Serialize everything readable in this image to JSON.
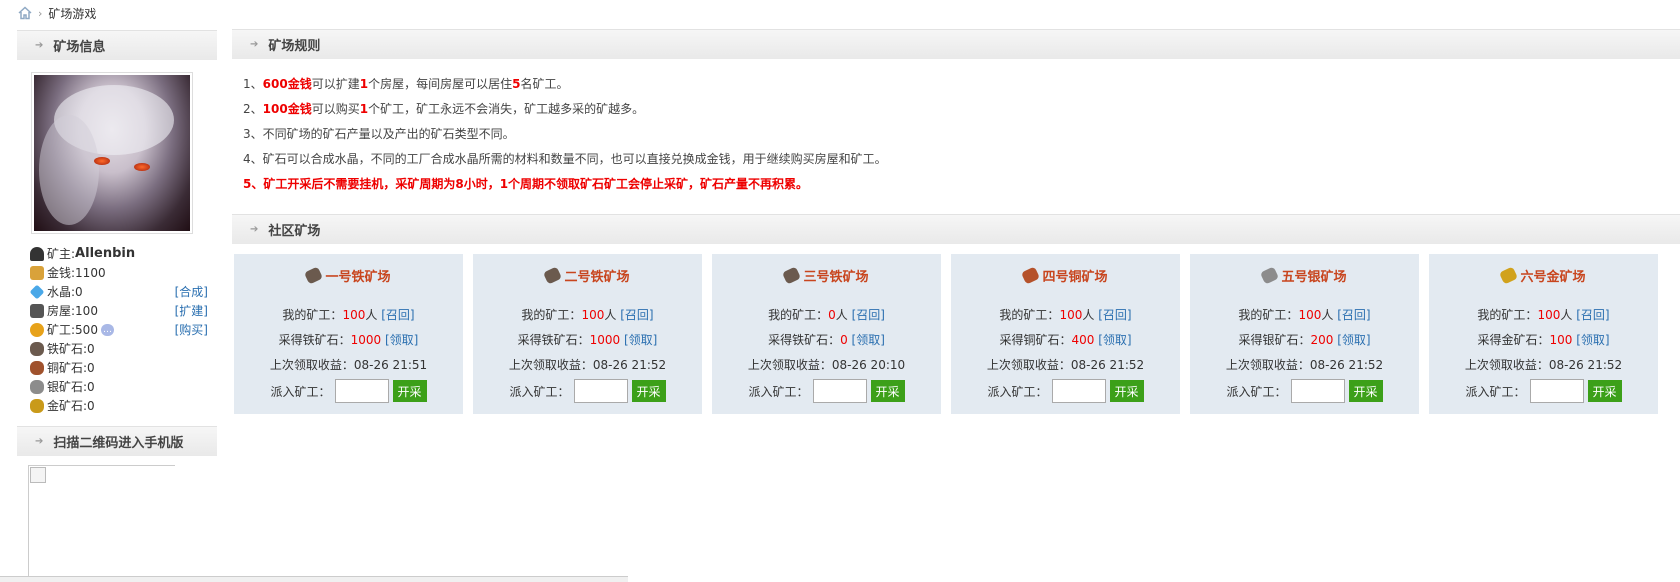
{
  "breadcrumb": {
    "current": "矿场游戏"
  },
  "left": {
    "info_title": "矿场信息",
    "qr_title": "扫描二维码进入手机版",
    "stats": [
      {
        "label": "矿主: ",
        "value": "Allenbin",
        "icon": "user-icon",
        "color": "#333333",
        "action": ""
      },
      {
        "label": "金钱: ",
        "value": "1100",
        "icon": "coins-icon",
        "color": "#d9a23a",
        "action": ""
      },
      {
        "label": "水晶: ",
        "value": "0",
        "icon": "crystal-icon",
        "color": "#4aa8e8",
        "action": "[合成]"
      },
      {
        "label": "房屋: ",
        "value": "100",
        "icon": "house-icon",
        "color": "#555555",
        "action": "[扩建]"
      },
      {
        "label": "矿工: ",
        "value": "500",
        "icon": "miner-icon",
        "color": "#e7a21a",
        "action": "[购买]"
      },
      {
        "label": "铁矿石: ",
        "value": "0",
        "icon": "iron-ore-icon",
        "color": "#6b5a4e",
        "action": ""
      },
      {
        "label": "铜矿石: ",
        "value": "0",
        "icon": "copper-ore-icon",
        "color": "#a0522d",
        "action": ""
      },
      {
        "label": "银矿石: ",
        "value": "0",
        "icon": "silver-ore-icon",
        "color": "#8c8c8c",
        "action": ""
      },
      {
        "label": "金矿石: ",
        "value": "0",
        "icon": "gold-ore-icon",
        "color": "#c99a1a",
        "action": ""
      }
    ]
  },
  "rules": {
    "title": "矿场规则",
    "r1": {
      "num": "1、",
      "a": "600金钱",
      "b": "可以扩建",
      "c": "1",
      "d": "个房屋，每间房屋可以居住",
      "e": "5",
      "f": "名矿工。"
    },
    "r2": {
      "num": "2、",
      "a": "100金钱",
      "b": "可以购买",
      "c": "1",
      "d": "个矿工，矿工永远不会消失，矿工越多采的矿越多。"
    },
    "r3": "3、不同矿场的矿石产量以及产出的矿石类型不同。",
    "r4": "4、矿石可以合成水晶，不同的工厂合成水晶所需的材料和数量不同，也可以直接兑换成金钱，用于继续购买房屋和矿工。",
    "r5": "5、矿工开采后不需要挂机，采矿周期为8小时，1个周期不领取矿石矿工会停止采矿，矿石产量不再积累。"
  },
  "mines_title": "社区矿场",
  "mines": [
    {
      "name": "一号铁矿场",
      "ore_color": "#6b5a4e",
      "workers_label": "我的矿工：",
      "workers": "100",
      "unit": "人",
      "recall": "[召回]",
      "ore_label": "采得铁矿石：",
      "ore": "1000",
      "collect": "[领取]",
      "last_label": "上次领取收益：",
      "last": "08-26 21:51",
      "dispatch_label": "派入矿工：",
      "button": "开采"
    },
    {
      "name": "二号铁矿场",
      "ore_color": "#6b5a4e",
      "workers_label": "我的矿工：",
      "workers": "100",
      "unit": "人",
      "recall": "[召回]",
      "ore_label": "采得铁矿石：",
      "ore": "1000",
      "collect": "[领取]",
      "last_label": "上次领取收益：",
      "last": "08-26 21:52",
      "dispatch_label": "派入矿工：",
      "button": "开采"
    },
    {
      "name": "三号铁矿场",
      "ore_color": "#6b5a4e",
      "workers_label": "我的矿工：",
      "workers": "0",
      "unit": "人",
      "recall": "[召回]",
      "ore_label": "采得铁矿石：",
      "ore": "0",
      "collect": "[领取]",
      "last_label": "上次领取收益：",
      "last": "08-26 20:10",
      "dispatch_label": "派入矿工：",
      "button": "开采"
    },
    {
      "name": "四号铜矿场",
      "ore_color": "#b5522b",
      "workers_label": "我的矿工：",
      "workers": "100",
      "unit": "人",
      "recall": "[召回]",
      "ore_label": "采得铜矿石：",
      "ore": "400",
      "collect": "[领取]",
      "last_label": "上次领取收益：",
      "last": "08-26 21:52",
      "dispatch_label": "派入矿工：",
      "button": "开采"
    },
    {
      "name": "五号银矿场",
      "ore_color": "#8c8c8c",
      "workers_label": "我的矿工：",
      "workers": "100",
      "unit": "人",
      "recall": "[召回]",
      "ore_label": "采得银矿石：",
      "ore": "200",
      "collect": "[领取]",
      "last_label": "上次领取收益：",
      "last": "08-26 21:52",
      "dispatch_label": "派入矿工：",
      "button": "开采"
    },
    {
      "name": "六号金矿场",
      "ore_color": "#d1a21c",
      "workers_label": "我的矿工：",
      "workers": "100",
      "unit": "人",
      "recall": "[召回]",
      "ore_label": "采得金矿石：",
      "ore": "100",
      "collect": "[领取]",
      "last_label": "上次领取收益：",
      "last": "08-26 21:52",
      "dispatch_label": "派入矿工：",
      "button": "开采"
    }
  ]
}
